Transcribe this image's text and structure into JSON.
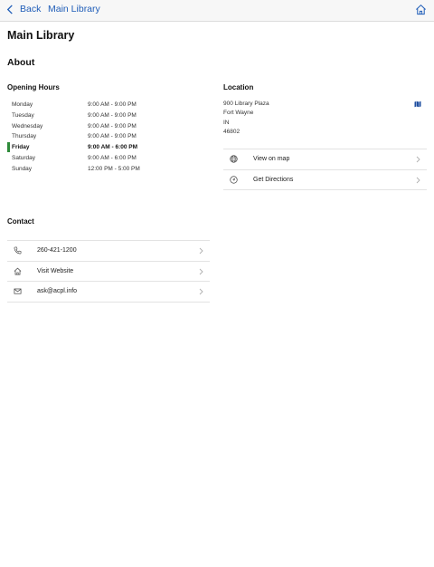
{
  "nav": {
    "back_label": "Back",
    "title": "Main Library"
  },
  "page": {
    "title": "Main Library",
    "section": "About"
  },
  "hours": {
    "title": "Opening Hours",
    "rows": [
      {
        "day": "Monday",
        "time": "9:00 AM - 9:00 PM"
      },
      {
        "day": "Tuesday",
        "time": "9:00 AM - 9:00 PM"
      },
      {
        "day": "Wednesday",
        "time": "9:00 AM - 9:00 PM"
      },
      {
        "day": "Thursday",
        "time": "9:00 AM - 9:00 PM"
      },
      {
        "day": "Friday",
        "time": "9:00 AM - 6:00 PM"
      },
      {
        "day": "Saturday",
        "time": "9:00 AM - 6:00 PM"
      },
      {
        "day": "Sunday",
        "time": "12:00 PM - 5:00 PM"
      }
    ],
    "today": "Friday"
  },
  "location": {
    "title": "Location",
    "address_lines": [
      "900 Library Plaza",
      "Fort Wayne",
      "IN",
      "46802"
    ],
    "actions": [
      {
        "label": "View on map",
        "icon": "globe-icon"
      },
      {
        "label": "Get Directions",
        "icon": "directions-icon"
      }
    ]
  },
  "contact": {
    "title": "Contact",
    "items": [
      {
        "label": "260-421-1200",
        "icon": "phone-icon"
      },
      {
        "label": "Visit Website",
        "icon": "home-icon"
      },
      {
        "label": "ask@acpl.info",
        "icon": "mail-icon"
      }
    ]
  },
  "colors": {
    "accent": "#1f5db8",
    "today_marker": "#2e8b3a",
    "divider": "#e3e3e3"
  }
}
